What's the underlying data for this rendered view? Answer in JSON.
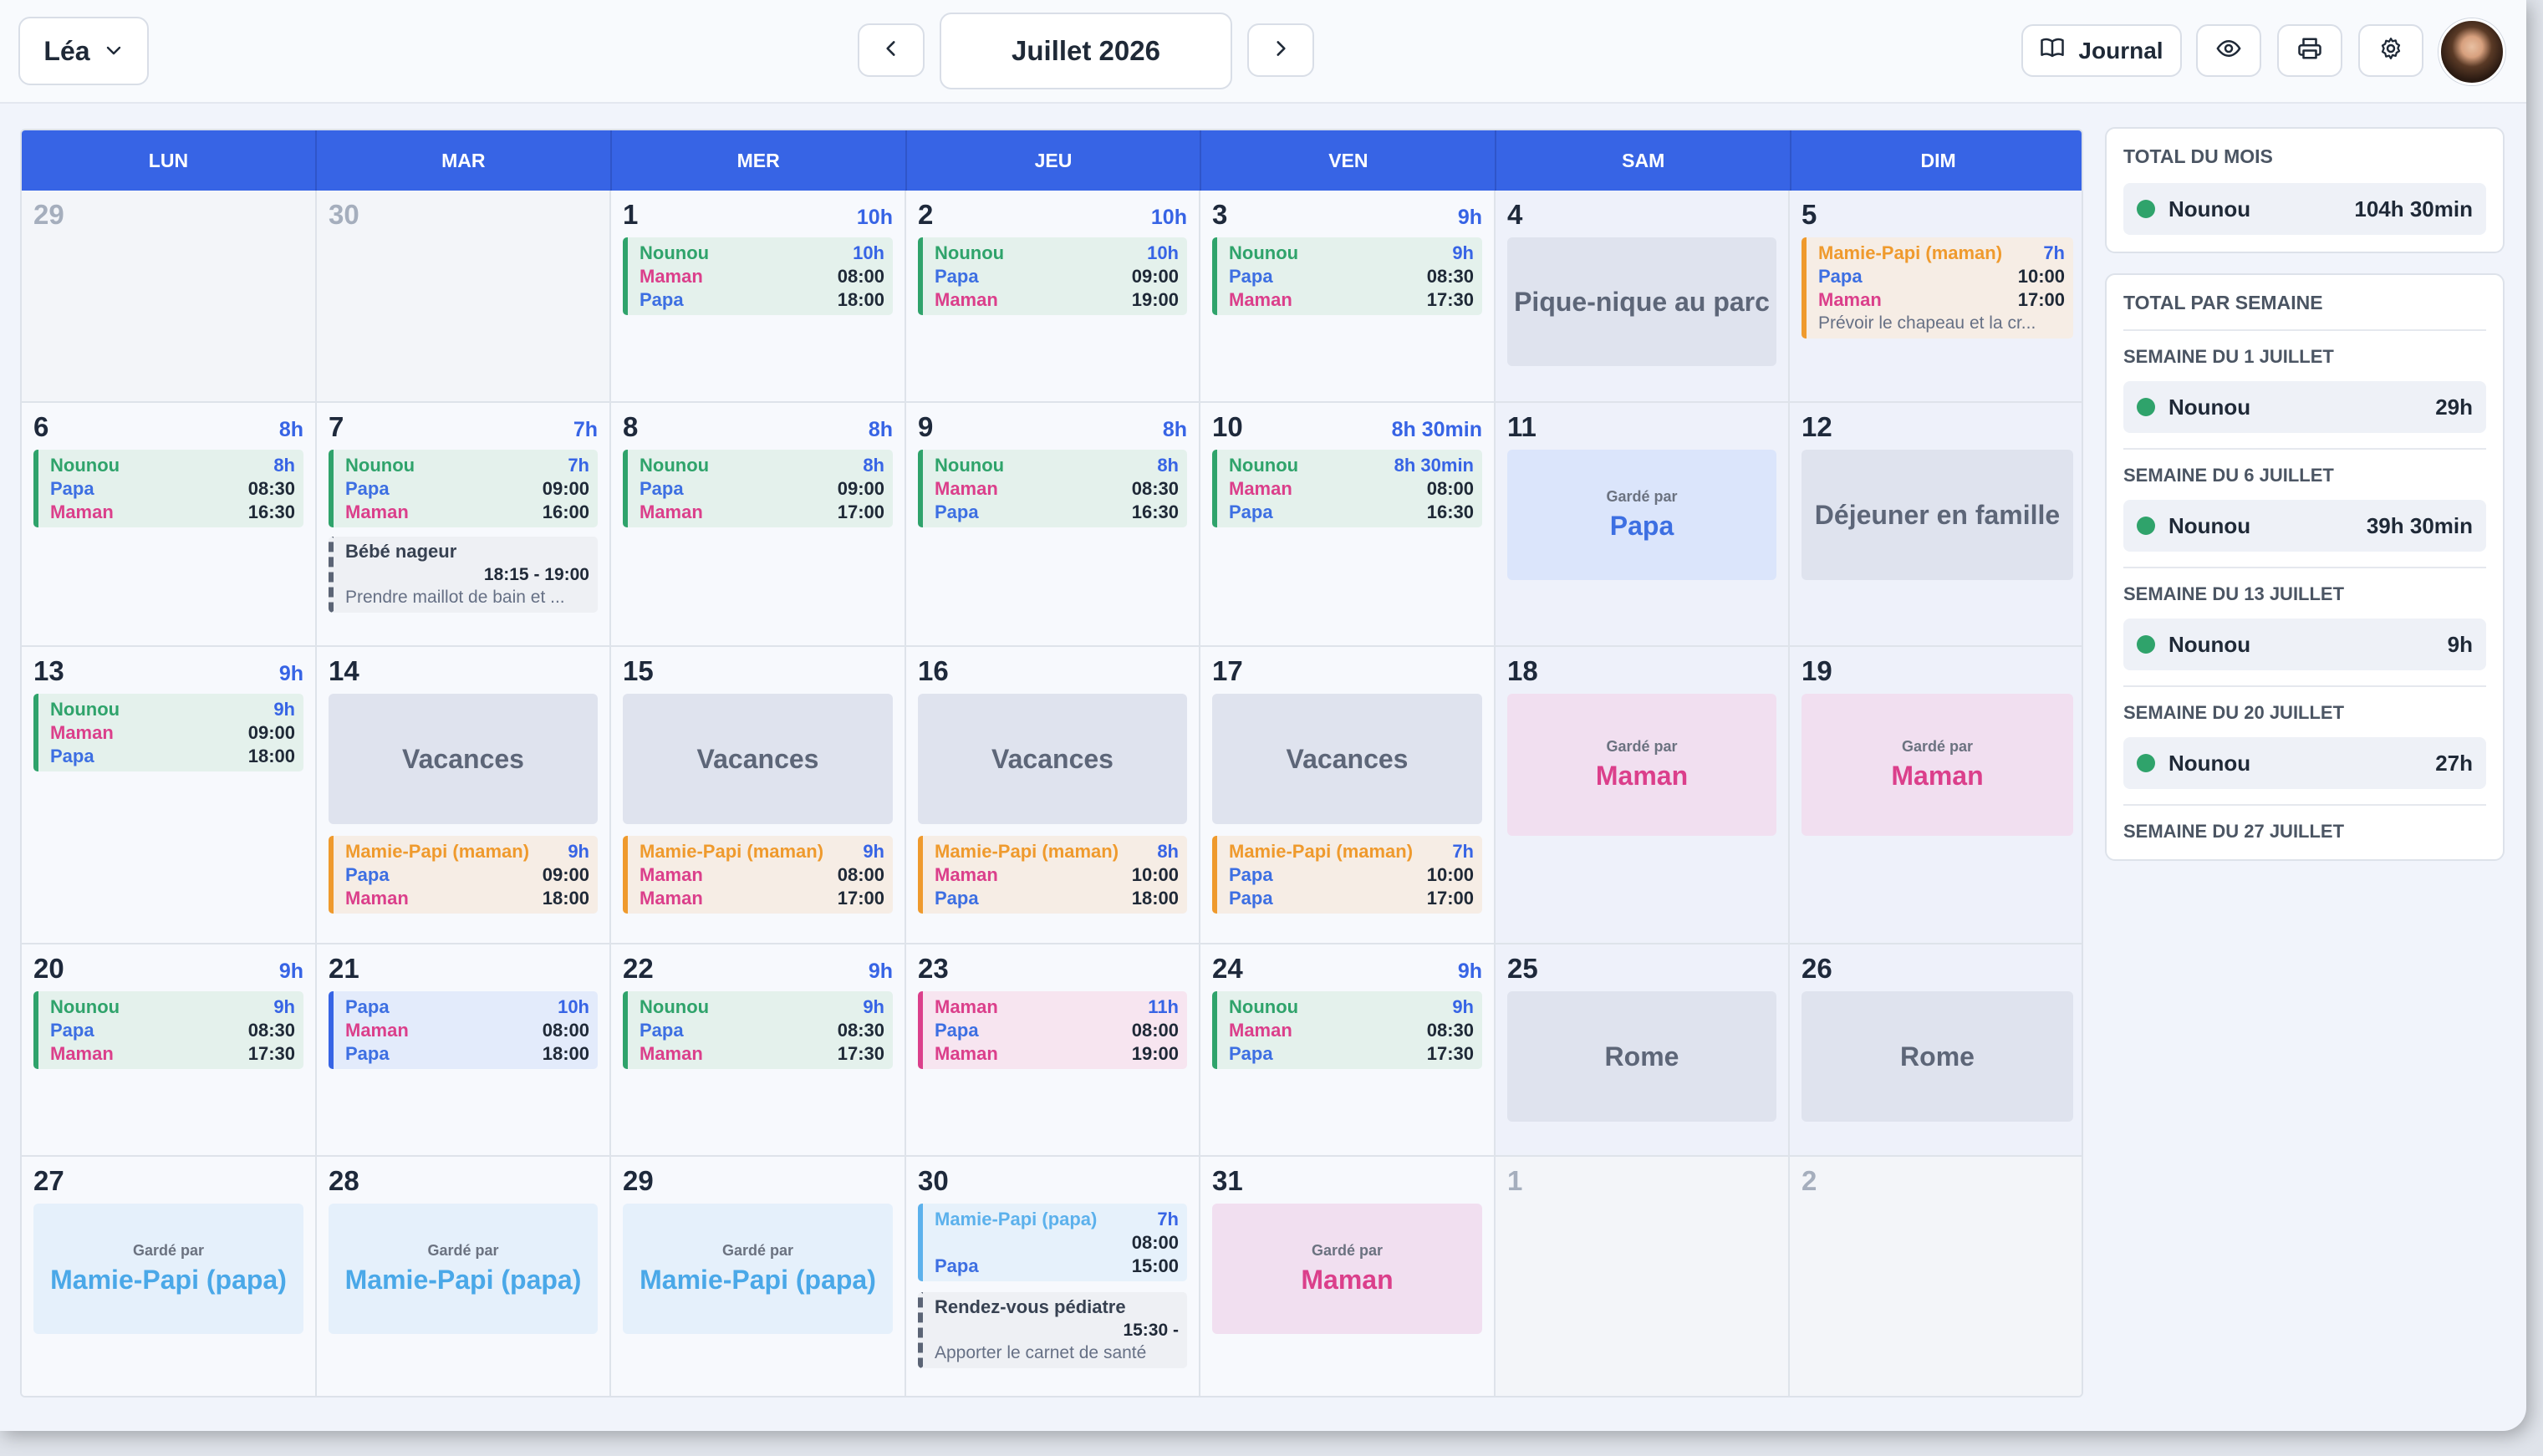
{
  "header": {
    "user": "Léa",
    "month": "Juillet 2026",
    "journal_label": "Journal"
  },
  "weekdays": [
    "LUN",
    "MAR",
    "MER",
    "JEU",
    "VEN",
    "SAM",
    "DIM"
  ],
  "labels": {
    "garde_par": "Gardé par",
    "vacances": "Vacances"
  },
  "colors": {
    "header_blue": "#3764e5",
    "nounou": "#2fa36b",
    "papa": "#3d6fe2",
    "maman": "#db3f8b",
    "mamie_papi_maman": "#ef9a2d",
    "mamie_papi_papa": "#5cb1ec"
  },
  "icons": [
    "chevron-down-icon",
    "chevron-left-icon",
    "chevron-right-icon",
    "book-icon",
    "eye-icon",
    "printer-icon",
    "gear-icon"
  ],
  "days": {
    "d29p": "29",
    "d30p": "30",
    "d1n": "1",
    "d2n": "2",
    "d1": {
      "num": "1",
      "total": "10h",
      "who": "Nounou",
      "who_dur": "10h",
      "drop": "Maman",
      "drop_time": "08:00",
      "pick": "Papa",
      "pick_time": "18:00"
    },
    "d2": {
      "num": "2",
      "total": "10h",
      "who": "Nounou",
      "who_dur": "10h",
      "drop": "Papa",
      "drop_time": "09:00",
      "pick": "Maman",
      "pick_time": "19:00"
    },
    "d3": {
      "num": "3",
      "total": "9h",
      "who": "Nounou",
      "who_dur": "9h",
      "drop": "Papa",
      "drop_time": "08:30",
      "pick": "Maman",
      "pick_time": "17:30"
    },
    "d4": {
      "num": "4",
      "event": "Pique-nique au parc"
    },
    "d5": {
      "num": "5",
      "who": "Mamie-Papi (maman)",
      "who_dur": "7h",
      "drop": "Papa",
      "drop_time": "10:00",
      "pick": "Maman",
      "pick_time": "17:00",
      "note": "Prévoir le chapeau et la cr..."
    },
    "d6": {
      "num": "6",
      "total": "8h",
      "who": "Nounou",
      "who_dur": "8h",
      "drop": "Papa",
      "drop_time": "08:30",
      "pick": "Maman",
      "pick_time": "16:30"
    },
    "d7": {
      "num": "7",
      "total": "7h",
      "who": "Nounou",
      "who_dur": "7h",
      "drop": "Papa",
      "drop_time": "09:00",
      "pick": "Maman",
      "pick_time": "16:00",
      "act_title": "Bébé nageur",
      "act_time": "18:15 - 19:00",
      "act_note": "Prendre maillot de bain et ..."
    },
    "d8": {
      "num": "8",
      "total": "8h",
      "who": "Nounou",
      "who_dur": "8h",
      "drop": "Papa",
      "drop_time": "09:00",
      "pick": "Maman",
      "pick_time": "17:00"
    },
    "d9": {
      "num": "9",
      "total": "8h",
      "who": "Nounou",
      "who_dur": "8h",
      "drop": "Maman",
      "drop_time": "08:30",
      "pick": "Papa",
      "pick_time": "16:30"
    },
    "d10": {
      "num": "10",
      "total": "8h 30min",
      "who": "Nounou",
      "who_dur": "8h 30min",
      "drop": "Maman",
      "drop_time": "08:00",
      "pick": "Papa",
      "pick_time": "16:30"
    },
    "d11": {
      "num": "11",
      "who": "Papa"
    },
    "d12": {
      "num": "12",
      "event": "Déjeuner en famille"
    },
    "d13": {
      "num": "13",
      "total": "9h",
      "who": "Nounou",
      "who_dur": "9h",
      "drop": "Maman",
      "drop_time": "09:00",
      "pick": "Papa",
      "pick_time": "18:00"
    },
    "d14": {
      "num": "14",
      "who": "Mamie-Papi (maman)",
      "who_dur": "9h",
      "drop": "Papa",
      "drop_time": "09:00",
      "pick": "Maman",
      "pick_time": "18:00"
    },
    "d15": {
      "num": "15",
      "who": "Mamie-Papi (maman)",
      "who_dur": "9h",
      "drop": "Maman",
      "drop_time": "08:00",
      "pick": "Maman",
      "pick_time": "17:00"
    },
    "d16": {
      "num": "16",
      "who": "Mamie-Papi (maman)",
      "who_dur": "8h",
      "drop": "Maman",
      "drop_time": "10:00",
      "pick": "Papa",
      "pick_time": "18:00"
    },
    "d17": {
      "num": "17",
      "who": "Mamie-Papi (maman)",
      "who_dur": "7h",
      "drop": "Papa",
      "drop_time": "10:00",
      "pick": "Papa",
      "pick_time": "17:00"
    },
    "d18": {
      "num": "18",
      "who": "Maman"
    },
    "d19": {
      "num": "19",
      "who": "Maman"
    },
    "d20": {
      "num": "20",
      "total": "9h",
      "who": "Nounou",
      "who_dur": "9h",
      "drop": "Papa",
      "drop_time": "08:30",
      "pick": "Maman",
      "pick_time": "17:30"
    },
    "d21": {
      "num": "21",
      "who": "Papa",
      "who_dur": "10h",
      "drop": "Maman",
      "drop_time": "08:00",
      "pick": "Papa",
      "pick_time": "18:00"
    },
    "d22": {
      "num": "22",
      "total": "9h",
      "who": "Nounou",
      "who_dur": "9h",
      "drop": "Papa",
      "drop_time": "08:30",
      "pick": "Maman",
      "pick_time": "17:30"
    },
    "d23": {
      "num": "23",
      "who": "Maman",
      "who_dur": "11h",
      "drop": "Papa",
      "drop_time": "08:00",
      "pick": "Maman",
      "pick_time": "19:00"
    },
    "d24": {
      "num": "24",
      "total": "9h",
      "who": "Nounou",
      "who_dur": "9h",
      "drop": "Maman",
      "drop_time": "08:30",
      "pick": "Papa",
      "pick_time": "17:30"
    },
    "d25": {
      "num": "25",
      "event": "Rome"
    },
    "d26": {
      "num": "26",
      "event": "Rome"
    },
    "d27": {
      "num": "27",
      "who": "Mamie-Papi (papa)"
    },
    "d28": {
      "num": "28",
      "who": "Mamie-Papi (papa)"
    },
    "d29": {
      "num": "29",
      "who": "Mamie-Papi (papa)"
    },
    "d30": {
      "num": "30",
      "who": "Mamie-Papi (papa)",
      "who_dur": "7h",
      "drop_time": "08:00",
      "pick": "Papa",
      "pick_time": "15:00",
      "act_title": "Rendez-vous pédiatre",
      "act_time": "15:30 -",
      "act_note": "Apporter le carnet de santé"
    },
    "d31": {
      "num": "31",
      "who": "Maman"
    }
  },
  "sidebar": {
    "month_title": "TOTAL DU MOIS",
    "month_total": {
      "name": "Nounou",
      "hours": "104h 30min"
    },
    "week_title": "TOTAL PAR SEMAINE",
    "weeks": [
      {
        "label": "SEMAINE DU 1 JUILLET",
        "name": "Nounou",
        "hours": "29h"
      },
      {
        "label": "SEMAINE DU 6 JUILLET",
        "name": "Nounou",
        "hours": "39h 30min"
      },
      {
        "label": "SEMAINE DU 13 JUILLET",
        "name": "Nounou",
        "hours": "9h"
      },
      {
        "label": "SEMAINE DU 20 JUILLET",
        "name": "Nounou",
        "hours": "27h"
      },
      {
        "label": "SEMAINE DU 27 JUILLET"
      }
    ]
  }
}
